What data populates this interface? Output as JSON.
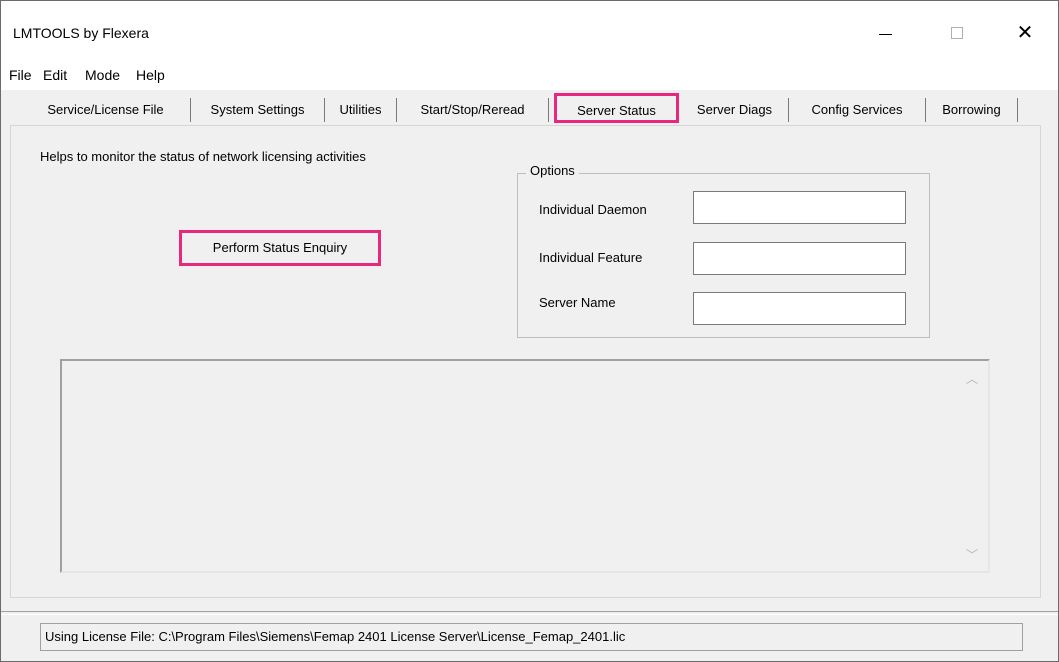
{
  "window": {
    "title": "LMTOOLS by Flexera",
    "minimize_glyph": "—",
    "maximize_glyph": "☐",
    "close_glyph": "✕"
  },
  "menu": [
    "File",
    "Edit",
    "Mode",
    "Help"
  ],
  "tabs": [
    {
      "label": "Service/License File"
    },
    {
      "label": "System Settings"
    },
    {
      "label": "Utilities"
    },
    {
      "label": "Start/Stop/Reread"
    },
    {
      "label": "Server Status",
      "selected": true
    },
    {
      "label": "Server Diags"
    },
    {
      "label": "Config Services"
    },
    {
      "label": "Borrowing"
    }
  ],
  "server_status": {
    "description": "Helps to monitor the status of network licensing activities",
    "enquiry_button": "Perform Status Enquiry",
    "options": {
      "title": "Options",
      "individual_daemon_label": "Individual Daemon",
      "individual_daemon_value": "",
      "individual_feature_label": "Individual Feature",
      "individual_feature_value": "",
      "server_name_label": "Server Name",
      "server_name_value": ""
    },
    "output_text": ""
  },
  "status_bar": {
    "text": "Using License File:  C:\\Program Files\\Siemens\\Femap 2401 License Server\\License_Femap_2401.lic"
  },
  "colors": {
    "highlight": "#e8287c",
    "window_bg": "#f0f0f0"
  },
  "icons": {
    "scroll_up": "chevron-up-icon",
    "scroll_down": "chevron-down-icon"
  }
}
